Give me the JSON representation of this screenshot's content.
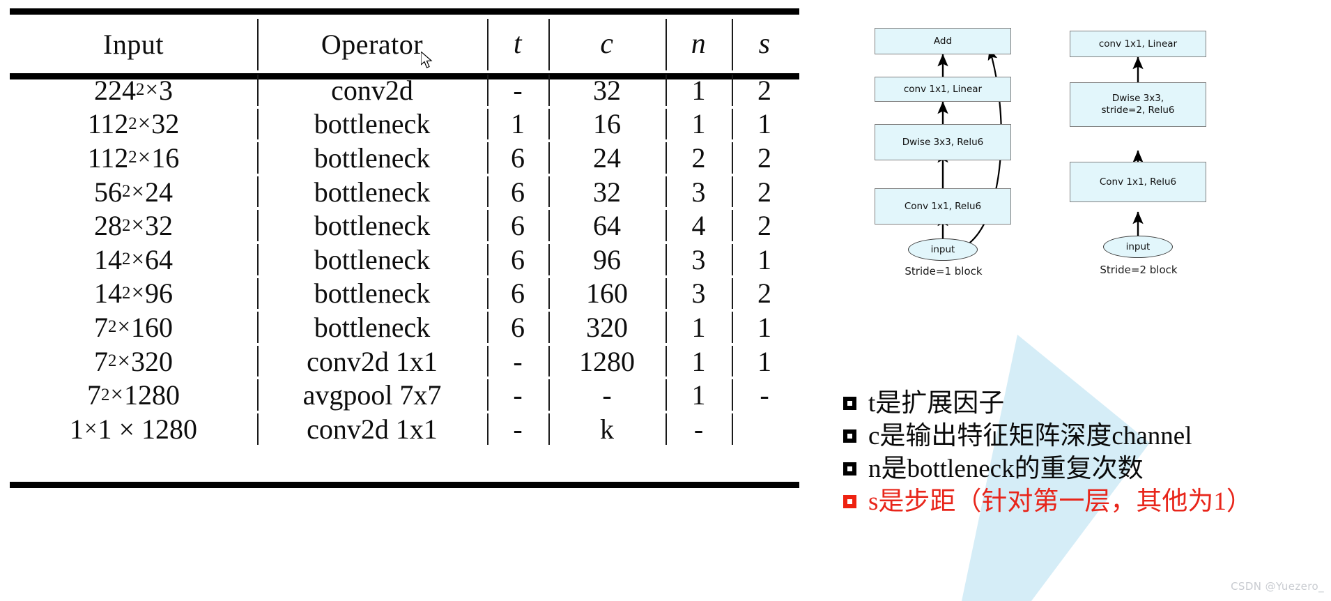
{
  "table": {
    "columns": [
      "Input",
      "Operator",
      "t",
      "c",
      "n",
      "s"
    ],
    "rows": [
      {
        "input_base": "224",
        "input_sup": "2",
        "input_tail": "3",
        "operator": "conv2d",
        "t": "-",
        "c": "32",
        "n": "1",
        "s": "2"
      },
      {
        "input_base": "112",
        "input_sup": "2",
        "input_tail": "32",
        "operator": "bottleneck",
        "t": "1",
        "c": "16",
        "n": "1",
        "s": "1"
      },
      {
        "input_base": "112",
        "input_sup": "2",
        "input_tail": "16",
        "operator": "bottleneck",
        "t": "6",
        "c": "24",
        "n": "2",
        "s": "2"
      },
      {
        "input_base": "56",
        "input_sup": "2",
        "input_tail": "24",
        "operator": "bottleneck",
        "t": "6",
        "c": "32",
        "n": "3",
        "s": "2"
      },
      {
        "input_base": "28",
        "input_sup": "2",
        "input_tail": "32",
        "operator": "bottleneck",
        "t": "6",
        "c": "64",
        "n": "4",
        "s": "2"
      },
      {
        "input_base": "14",
        "input_sup": "2",
        "input_tail": "64",
        "operator": "bottleneck",
        "t": "6",
        "c": "96",
        "n": "3",
        "s": "1"
      },
      {
        "input_base": "14",
        "input_sup": "2",
        "input_tail": "96",
        "operator": "bottleneck",
        "t": "6",
        "c": "160",
        "n": "3",
        "s": "2"
      },
      {
        "input_base": "7",
        "input_sup": "2",
        "input_tail": "160",
        "operator": "bottleneck",
        "t": "6",
        "c": "320",
        "n": "1",
        "s": "1"
      },
      {
        "input_base": "7",
        "input_sup": "2",
        "input_tail": "320",
        "operator": "conv2d 1x1",
        "t": "-",
        "c": "1280",
        "n": "1",
        "s": "1"
      },
      {
        "input_base": "7",
        "input_sup": "2",
        "input_tail": "1280",
        "operator": "avgpool 7x7",
        "t": "-",
        "c": "-",
        "n": "1",
        "s": "-"
      },
      {
        "input_base": "1",
        "input_sup": "",
        "input_tail": "1 × 1280",
        "operator": "conv2d 1x1",
        "t": "-",
        "c": "k",
        "n": "-",
        "s": ""
      }
    ]
  },
  "diagrams": {
    "stride1": {
      "caption": "Stride=1 block",
      "nodes": {
        "add": "Add",
        "conv_linear": "conv 1x1, Linear",
        "dwise": "Dwise 3x3, Relu6",
        "conv_relu": "Conv 1x1, Relu6",
        "input": "input"
      }
    },
    "stride2": {
      "caption": "Stride=2 block",
      "nodes": {
        "conv_linear": "conv 1x1, Linear",
        "dwise": "Dwise 3x3,\nstride=2, Relu6",
        "conv_relu": "Conv 1x1, Relu6",
        "input": "input"
      }
    }
  },
  "notes": {
    "items": [
      {
        "text": "t是扩展因子",
        "accent": false
      },
      {
        "text": "c是输出特征矩阵深度channel",
        "accent": false
      },
      {
        "text": "n是bottleneck的重复次数",
        "accent": false
      },
      {
        "text": "s是步距（针对第一层，其他为1）",
        "accent": true
      }
    ]
  },
  "watermark": "CSDN @Yuezero_",
  "colors": {
    "node_fill": "#e2f6fb",
    "node_border": "#808080",
    "accent_red": "#e8251a",
    "triangle_blue": "#d5edf7",
    "rule_black": "#000000"
  }
}
